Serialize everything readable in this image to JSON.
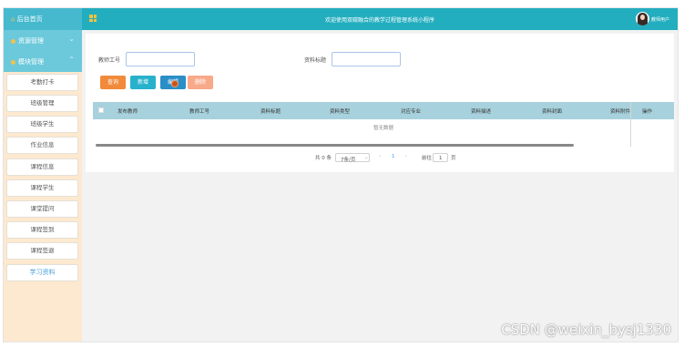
{
  "sidebar": {
    "home": "后台首页",
    "menus": [
      {
        "label": "资源管理",
        "arrow": "⌄"
      },
      {
        "label": "模块管理",
        "arrow": "⌃"
      }
    ],
    "items": [
      {
        "label": "考勤打卡"
      },
      {
        "label": "班级管理"
      },
      {
        "label": "班级学生"
      },
      {
        "label": "作业信息"
      },
      {
        "label": "课程信息"
      },
      {
        "label": "课程学生"
      },
      {
        "label": "课堂提问"
      },
      {
        "label": "课程签到"
      },
      {
        "label": "课程签退"
      },
      {
        "label": "学习资料"
      }
    ]
  },
  "header": {
    "title": "欢迎使用双碳融合的教学过程管理系统小程序",
    "user": "教师用户"
  },
  "search": {
    "teacher_no_label": "教师工号",
    "title_label": "资料标题"
  },
  "buttons": {
    "search": "查询",
    "add": "新增",
    "edit": "编辑",
    "delete": "删除"
  },
  "table": {
    "columns": [
      "发布教师",
      "教师工号",
      "资料标题",
      "资料类型",
      "对应专业",
      "资料描述",
      "资料封面",
      "资料附件",
      "操作"
    ],
    "empty": "暂无数据"
  },
  "pagination": {
    "total": "共 0 条",
    "page_size": "7条/页",
    "prev": "‹",
    "current_page": "1",
    "next": "›",
    "goto": "前往",
    "goto_value": "1",
    "page_unit": "页"
  },
  "watermark": "CSDN @weixin_bysj1330",
  "colors": {
    "header": "#23aebf",
    "sidebar": "#fde9cf",
    "search_btn": "#f18a3a",
    "add_btn": "#27b1cc",
    "edit_btn": "#2a8ec7",
    "delete_btn": "#f8a98a"
  }
}
